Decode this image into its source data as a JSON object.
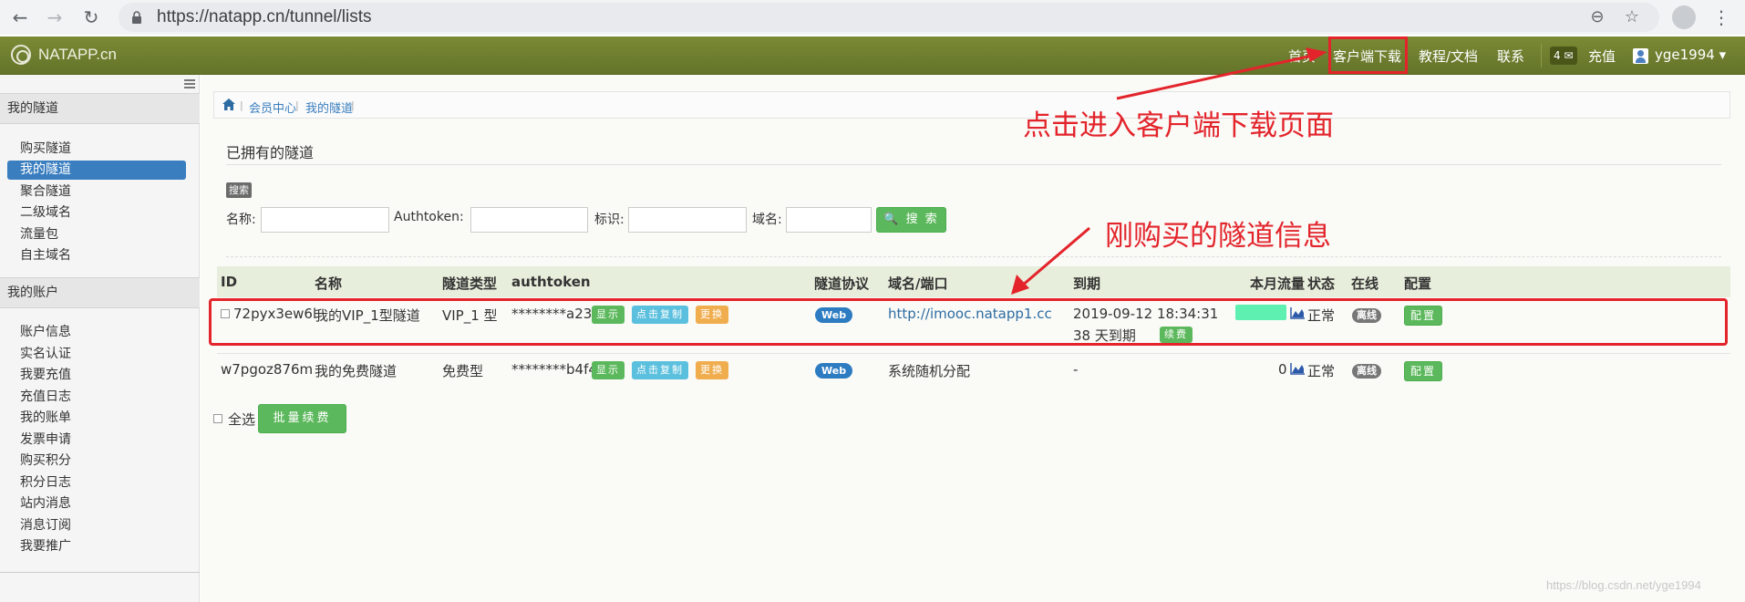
{
  "browser": {
    "url": "https://natapp.cn/tunnel/lists"
  },
  "topnav": {
    "brand": "NATAPP.cn",
    "links": [
      "首页",
      "客户端下载",
      "教程/文档",
      "联系"
    ],
    "message_count": "4",
    "recharge": "充值",
    "username": "yge1994"
  },
  "sidebar": {
    "section1": {
      "title": "我的隧道",
      "items": [
        "购买隧道",
        "我的隧道",
        "聚合隧道",
        "二级域名",
        "流量包",
        "自主域名"
      ],
      "active": "我的隧道"
    },
    "section2": {
      "title": "我的账户",
      "items": [
        "账户信息",
        "实名认证",
        "我要充值",
        "充值日志",
        "我的账单",
        "发票申请",
        "购买积分",
        "积分日志",
        "站内消息",
        "消息订阅",
        "我要推广"
      ]
    }
  },
  "breadcrumb": [
    "会员中心",
    "我的隧道"
  ],
  "page_title": "已拥有的隧道",
  "search": {
    "tag": "搜索",
    "name_label": "名称:",
    "authtoken_label": "Authtoken:",
    "flag_label": "标识:",
    "domain_label": "域名:",
    "button": "搜 索"
  },
  "table": {
    "headers": [
      "ID",
      "名称",
      "隧道类型",
      "authtoken",
      "隧道协议",
      "域名/端口",
      "到期",
      "本月流量",
      "状态",
      "在线",
      "配置"
    ],
    "rows": [
      {
        "id": "72pyx3ew6l",
        "name": "我的VIP_1型隧道",
        "type": "VIP_1 型",
        "authtoken": "********a235",
        "btn_show": "显示",
        "btn_copy": "点击复制",
        "btn_change": "更换",
        "protocol": "Web",
        "domain": "http://imooc.natapp1.cc",
        "expire": "2019-09-12 18:34:31",
        "expire_days": "38 天到期",
        "renew": "续费",
        "traffic": "",
        "status": "正常",
        "online": "离线",
        "config": "配置"
      },
      {
        "id": "w7pgoz876m",
        "name": "我的免费隧道",
        "type": "免费型",
        "authtoken": "********b4f4",
        "btn_show": "显示",
        "btn_copy": "点击复制",
        "btn_change": "更换",
        "protocol": "Web",
        "domain": "系统随机分配",
        "expire": "-",
        "traffic": "0",
        "status": "正常",
        "online": "离线",
        "config": "配置"
      }
    ]
  },
  "footer": {
    "select_all": "全选",
    "batch_renew": "批量续费"
  },
  "annotations": {
    "client_download": "点击进入客户端下载页面",
    "new_tunnel": "刚购买的隧道信息"
  },
  "watermark": "https://blog.csdn.net/yge1994",
  "colors": {
    "navbar": "#6e7e2f",
    "highlight": "#e3242b",
    "sidebar_active": "#3a7ebf",
    "button_green": "#5cb85c"
  }
}
